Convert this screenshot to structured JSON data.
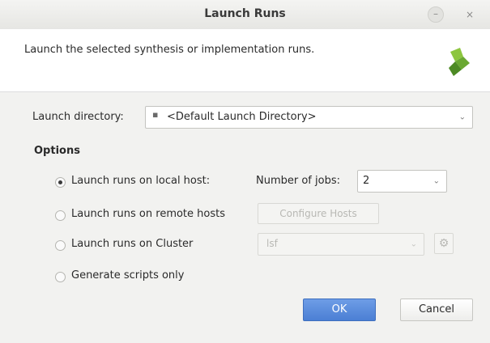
{
  "window": {
    "title": "Launch Runs",
    "minimize_glyph": "–",
    "close_glyph": "×"
  },
  "header": {
    "description": "Launch the selected synthesis or implementation runs.",
    "logo_icon": "vivado-logo-icon"
  },
  "launch_directory": {
    "label": "Launch directory:",
    "value": "<Default Launch Directory>",
    "item_icon": "bullet-icon"
  },
  "options": {
    "heading": "Options",
    "local": {
      "label": "Launch runs on local host:",
      "selected": true
    },
    "jobs": {
      "label": "Number of jobs:",
      "value": "2"
    },
    "remote": {
      "label": "Launch runs on remote hosts",
      "selected": false
    },
    "configure_hosts": {
      "label": "Configure Hosts"
    },
    "cluster": {
      "label": "Launch runs on Cluster",
      "selected": false,
      "value": "lsf"
    },
    "scripts": {
      "label": "Generate scripts only",
      "selected": false
    }
  },
  "buttons": {
    "ok": "OK",
    "cancel": "Cancel"
  },
  "colors": {
    "primary_button": "#4b7fd4",
    "titlebar": "#e9e9e6",
    "panel": "#f2f2f0"
  }
}
